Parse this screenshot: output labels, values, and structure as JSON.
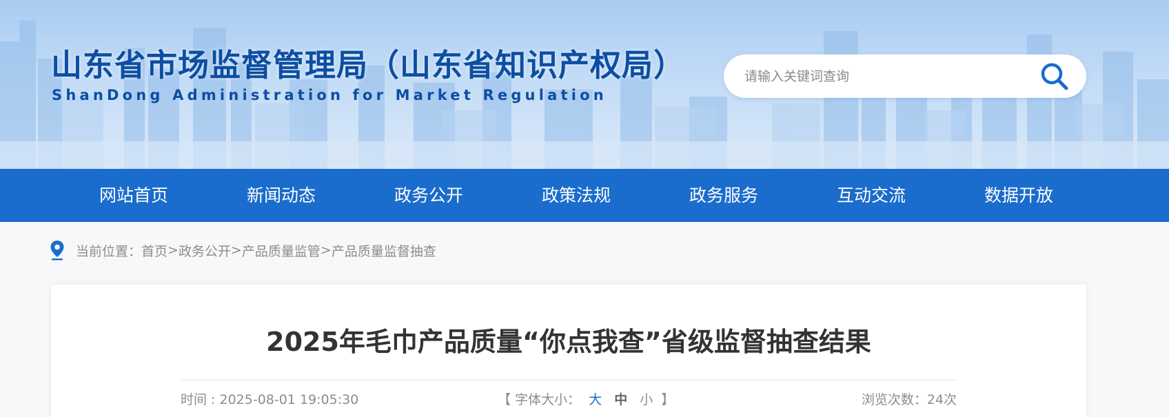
{
  "header": {
    "title": "山东省市场监督管理局（山东省知识产权局）",
    "subtitle": "ShanDong Administration for Market Regulation",
    "search": {
      "placeholder": "请输入关键词查询"
    }
  },
  "nav": {
    "items": [
      {
        "label": "网站首页"
      },
      {
        "label": "新闻动态"
      },
      {
        "label": "政务公开"
      },
      {
        "label": "政策法规"
      },
      {
        "label": "政务服务"
      },
      {
        "label": "互动交流"
      },
      {
        "label": "数据开放"
      }
    ]
  },
  "breadcrumb": {
    "prefix": "当前位置：",
    "items": [
      "首页",
      "政务公开",
      "产品质量监管",
      "产品质量监督抽查"
    ],
    "separator": ">"
  },
  "article": {
    "title": "2025年毛巾产品质量“你点我查”省级监督抽查结果",
    "time": "时间 : 2025-08-01 19:05:30",
    "font_size": {
      "open_bracket": "【",
      "label": "字体大小：",
      "large": "大",
      "medium": "中",
      "small": "小",
      "close_bracket": "】"
    },
    "views": "浏览次数：24次"
  },
  "colors": {
    "brand_blue": "#1a6ccd",
    "title_blue": "#0d4ea3",
    "banner_sky": "#a9ccf2"
  }
}
